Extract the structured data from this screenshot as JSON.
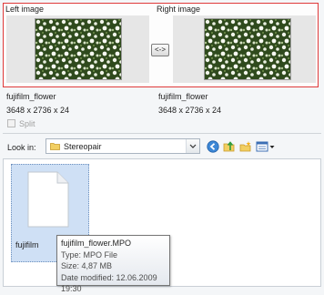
{
  "stereo_pair": {
    "left_label": "Left image",
    "right_label": "Right image",
    "swap_label": "<->",
    "left_info": {
      "name": "fujifilm_flower",
      "dimensions": "3648 x 2736 x 24"
    },
    "right_info": {
      "name": "fujifilm_flower",
      "dimensions": "3648 x 2736 x 24"
    },
    "split_label": "Split",
    "split_checked": false,
    "frame_color": "#e03a3a"
  },
  "browser": {
    "look_in_label": "Look in:",
    "look_in_value": "Stereopair",
    "toolbar_icons": [
      "back-icon",
      "up-folder-icon",
      "new-folder-icon",
      "view-menu-icon"
    ],
    "files": [
      {
        "label": "fujifilm",
        "icon": "document-icon",
        "selected": true
      }
    ]
  },
  "tooltip": {
    "name": "fujifilm_flower.MPO",
    "type": "Type: MPO File",
    "size": "Size: 4,87 MB",
    "modified": "Date modified: 12.06.2009 19:30"
  }
}
